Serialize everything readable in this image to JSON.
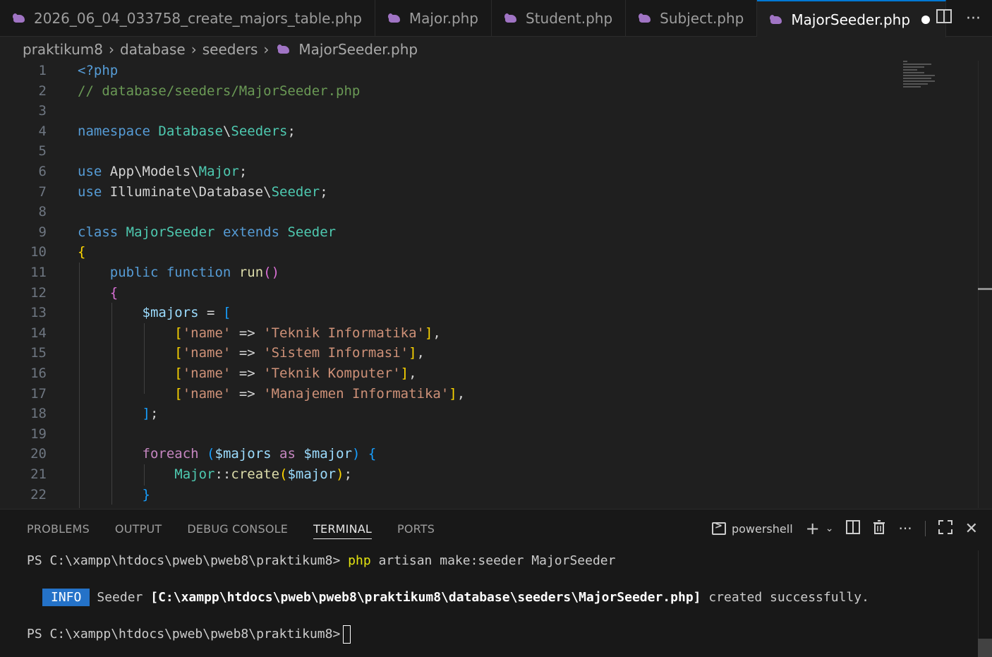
{
  "tabs": [
    {
      "label": "2026_06_04_033758_create_majors_table.php",
      "active": false
    },
    {
      "label": "Major.php",
      "active": false
    },
    {
      "label": "Student.php",
      "active": false
    },
    {
      "label": "Subject.php",
      "active": false
    },
    {
      "label": "MajorSeeder.php",
      "active": true,
      "modified": true
    }
  ],
  "breadcrumb": [
    "praktikum8",
    "database",
    "seeders",
    "MajorSeeder.php"
  ],
  "editor": {
    "line_numbers": [
      "1",
      "2",
      "3",
      "4",
      "5",
      "6",
      "7",
      "8",
      "9",
      "10",
      "11",
      "12",
      "13",
      "14",
      "15",
      "16",
      "17",
      "18",
      "19",
      "20",
      "21",
      "22"
    ]
  },
  "panel": {
    "tabs": [
      "PROBLEMS",
      "OUTPUT",
      "DEBUG CONSOLE",
      "TERMINAL",
      "PORTS"
    ],
    "active_tab": "TERMINAL",
    "shell_label": "powershell",
    "terminal": {
      "prompt": "PS C:\\xampp\\htdocs\\pweb\\pweb8\\praktikum8>",
      "command_php": "php",
      "command_rest": "artisan make:seeder MajorSeeder",
      "info_badge": "INFO",
      "info_prefix": "Seeder",
      "info_path": "[C:\\xampp\\htdocs\\pweb\\pweb8\\praktikum8\\database\\seeders\\MajorSeeder.php]",
      "info_suffix": "created successfully.",
      "prompt2": "PS C:\\xampp\\htdocs\\pweb\\pweb8\\praktikum8>"
    }
  },
  "colors": {
    "accent": "#0078d4",
    "info_badge": "#2472c8",
    "php_icon": "#a074c4"
  }
}
